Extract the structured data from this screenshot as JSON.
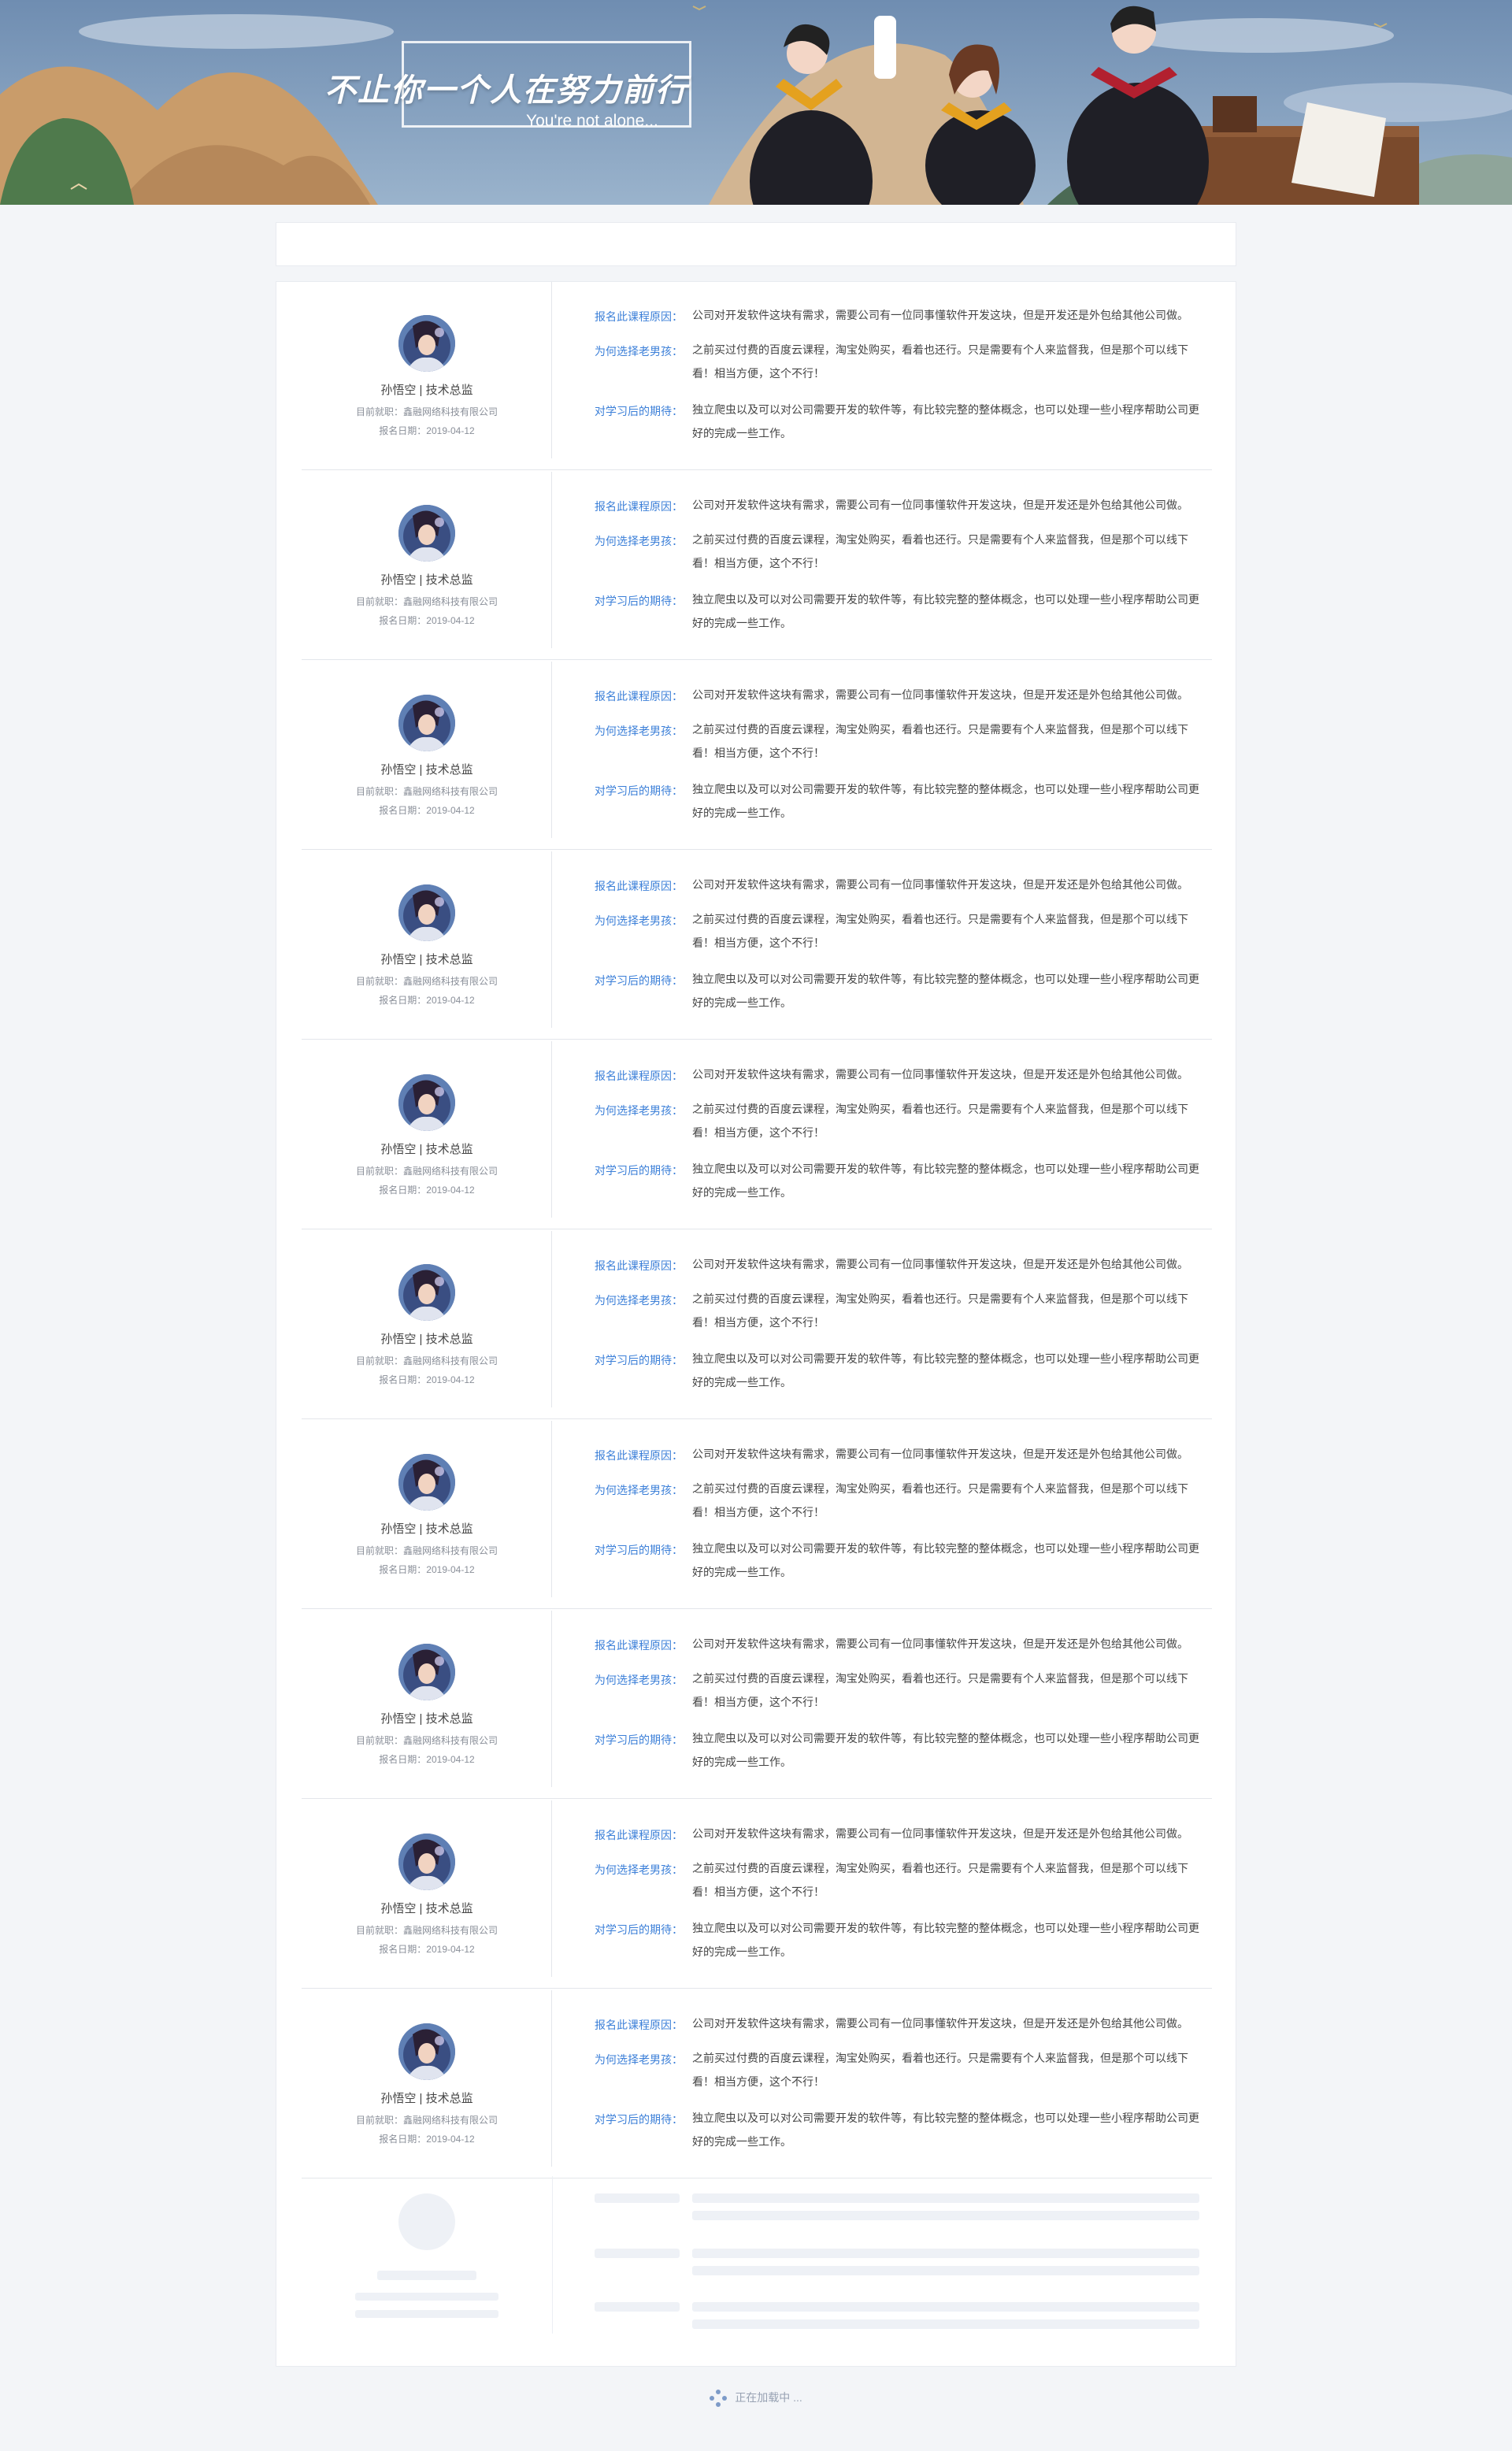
{
  "banner": {
    "slogan": "不止你一个人在努力前行",
    "subtitle": "You're not alone..."
  },
  "labels": {
    "reason": "报名此课程原因：",
    "why_teacher": "为何选择老男孩：",
    "expectation": "对学习后的期待："
  },
  "entries": [
    {
      "name": "孙悟空 | 技术总监",
      "company": "目前就职：鑫融网络科技有限公司",
      "date": "报名日期：2019-04-12",
      "reason": "公司对开发软件这块有需求，需要公司有一位同事懂软件开发这块，但是开发还是外包给其他公司做。",
      "why_teacher": "之前买过付费的百度云课程，淘宝处购买，看着也还行。只是需要有个人来监督我，但是那个可以线下看！相当方便，这个不行！",
      "expectation": "独立爬虫以及可以对公司需要开发的软件等，有比较完整的整体概念，也可以处理一些小程序帮助公司更好的完成一些工作。"
    },
    {
      "name": "孙悟空 | 技术总监",
      "company": "目前就职：鑫融网络科技有限公司",
      "date": "报名日期：2019-04-12",
      "reason": "公司对开发软件这块有需求，需要公司有一位同事懂软件开发这块，但是开发还是外包给其他公司做。",
      "why_teacher": "之前买过付费的百度云课程，淘宝处购买，看着也还行。只是需要有个人来监督我，但是那个可以线下看！相当方便，这个不行！",
      "expectation": "独立爬虫以及可以对公司需要开发的软件等，有比较完整的整体概念，也可以处理一些小程序帮助公司更好的完成一些工作。"
    },
    {
      "name": "孙悟空 | 技术总监",
      "company": "目前就职：鑫融网络科技有限公司",
      "date": "报名日期：2019-04-12",
      "reason": "公司对开发软件这块有需求，需要公司有一位同事懂软件开发这块，但是开发还是外包给其他公司做。",
      "why_teacher": "之前买过付费的百度云课程，淘宝处购买，看着也还行。只是需要有个人来监督我，但是那个可以线下看！相当方便，这个不行！",
      "expectation": "独立爬虫以及可以对公司需要开发的软件等，有比较完整的整体概念，也可以处理一些小程序帮助公司更好的完成一些工作。"
    },
    {
      "name": "孙悟空 | 技术总监",
      "company": "目前就职：鑫融网络科技有限公司",
      "date": "报名日期：2019-04-12",
      "reason": "公司对开发软件这块有需求，需要公司有一位同事懂软件开发这块，但是开发还是外包给其他公司做。",
      "why_teacher": "之前买过付费的百度云课程，淘宝处购买，看着也还行。只是需要有个人来监督我，但是那个可以线下看！相当方便，这个不行！",
      "expectation": "独立爬虫以及可以对公司需要开发的软件等，有比较完整的整体概念，也可以处理一些小程序帮助公司更好的完成一些工作。"
    },
    {
      "name": "孙悟空 | 技术总监",
      "company": "目前就职：鑫融网络科技有限公司",
      "date": "报名日期：2019-04-12",
      "reason": "公司对开发软件这块有需求，需要公司有一位同事懂软件开发这块，但是开发还是外包给其他公司做。",
      "why_teacher": "之前买过付费的百度云课程，淘宝处购买，看着也还行。只是需要有个人来监督我，但是那个可以线下看！相当方便，这个不行！",
      "expectation": "独立爬虫以及可以对公司需要开发的软件等，有比较完整的整体概念，也可以处理一些小程序帮助公司更好的完成一些工作。"
    },
    {
      "name": "孙悟空 | 技术总监",
      "company": "目前就职：鑫融网络科技有限公司",
      "date": "报名日期：2019-04-12",
      "reason": "公司对开发软件这块有需求，需要公司有一位同事懂软件开发这块，但是开发还是外包给其他公司做。",
      "why_teacher": "之前买过付费的百度云课程，淘宝处购买，看着也还行。只是需要有个人来监督我，但是那个可以线下看！相当方便，这个不行！",
      "expectation": "独立爬虫以及可以对公司需要开发的软件等，有比较完整的整体概念，也可以处理一些小程序帮助公司更好的完成一些工作。"
    },
    {
      "name": "孙悟空 | 技术总监",
      "company": "目前就职：鑫融网络科技有限公司",
      "date": "报名日期：2019-04-12",
      "reason": "公司对开发软件这块有需求，需要公司有一位同事懂软件开发这块，但是开发还是外包给其他公司做。",
      "why_teacher": "之前买过付费的百度云课程，淘宝处购买，看着也还行。只是需要有个人来监督我，但是那个可以线下看！相当方便，这个不行！",
      "expectation": "独立爬虫以及可以对公司需要开发的软件等，有比较完整的整体概念，也可以处理一些小程序帮助公司更好的完成一些工作。"
    },
    {
      "name": "孙悟空 | 技术总监",
      "company": "目前就职：鑫融网络科技有限公司",
      "date": "报名日期：2019-04-12",
      "reason": "公司对开发软件这块有需求，需要公司有一位同事懂软件开发这块，但是开发还是外包给其他公司做。",
      "why_teacher": "之前买过付费的百度云课程，淘宝处购买，看着也还行。只是需要有个人来监督我，但是那个可以线下看！相当方便，这个不行！",
      "expectation": "独立爬虫以及可以对公司需要开发的软件等，有比较完整的整体概念，也可以处理一些小程序帮助公司更好的完成一些工作。"
    },
    {
      "name": "孙悟空 | 技术总监",
      "company": "目前就职：鑫融网络科技有限公司",
      "date": "报名日期：2019-04-12",
      "reason": "公司对开发软件这块有需求，需要公司有一位同事懂软件开发这块，但是开发还是外包给其他公司做。",
      "why_teacher": "之前买过付费的百度云课程，淘宝处购买，看着也还行。只是需要有个人来监督我，但是那个可以线下看！相当方便，这个不行！",
      "expectation": "独立爬虫以及可以对公司需要开发的软件等，有比较完整的整体概念，也可以处理一些小程序帮助公司更好的完成一些工作。"
    },
    {
      "name": "孙悟空 | 技术总监",
      "company": "目前就职：鑫融网络科技有限公司",
      "date": "报名日期：2019-04-12",
      "reason": "公司对开发软件这块有需求，需要公司有一位同事懂软件开发这块，但是开发还是外包给其他公司做。",
      "why_teacher": "之前买过付费的百度云课程，淘宝处购买，看着也还行。只是需要有个人来监督我，但是那个可以线下看！相当方便，这个不行！",
      "expectation": "独立爬虫以及可以对公司需要开发的软件等，有比较完整的整体概念，也可以处理一些小程序帮助公司更好的完成一些工作。"
    }
  ],
  "loading": {
    "text": "正在加载中 ...",
    "icon": "spinner-icon"
  },
  "colors": {
    "accent": "#3b7fd8",
    "banner_bg": "#7b97b8",
    "page_bg": "#f3f5f8",
    "skeleton": "#eef1f6"
  }
}
